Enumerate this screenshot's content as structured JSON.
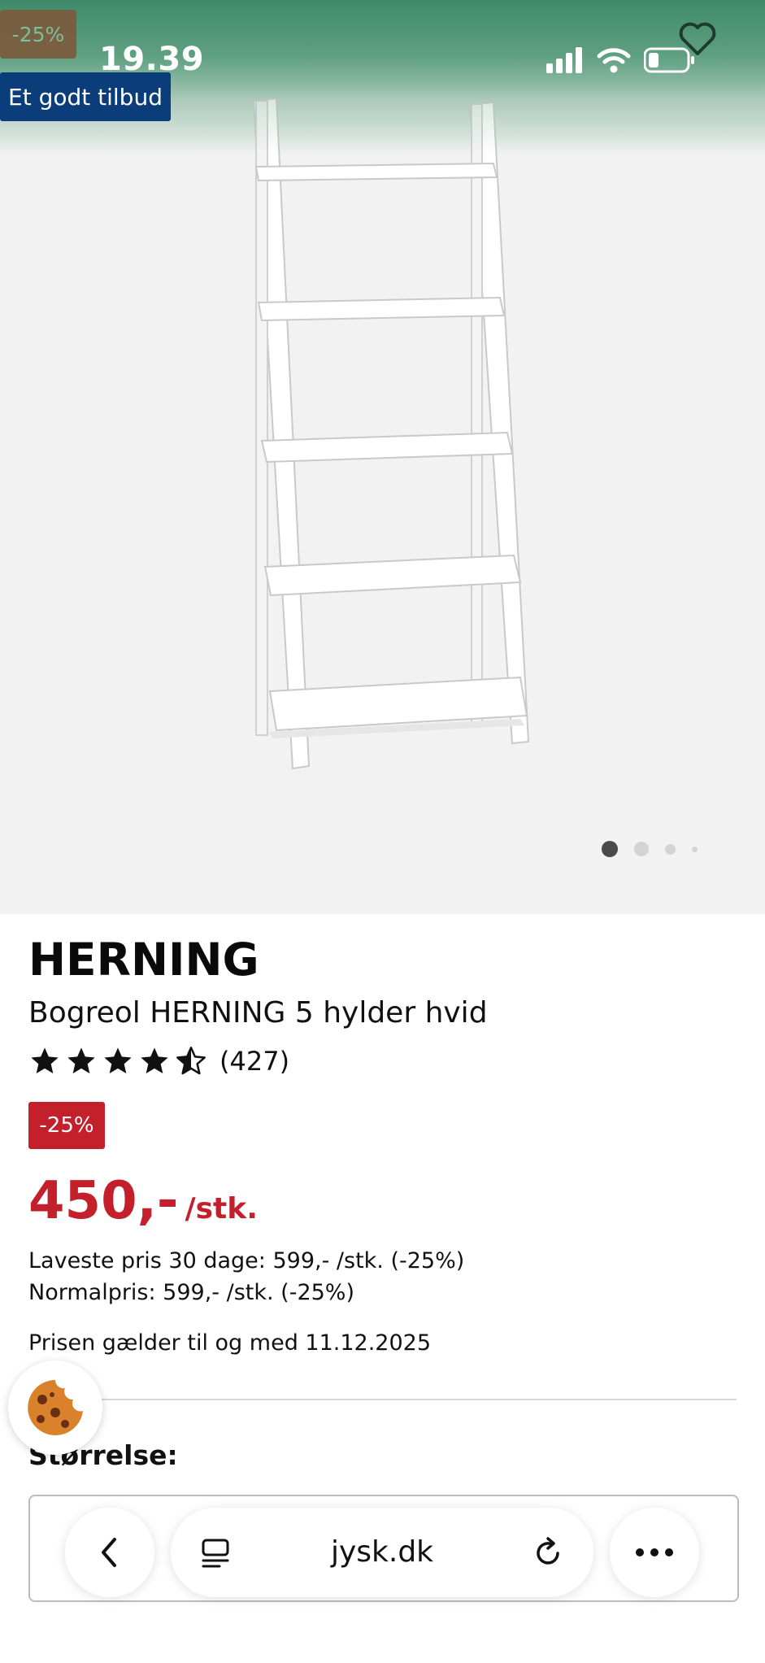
{
  "status_bar": {
    "time": "19.39"
  },
  "hero": {
    "discount_badge": "-25%",
    "offer_tag": "Et godt tilbud",
    "carousel": {
      "count": 4,
      "active_index": 0
    }
  },
  "product": {
    "brand": "HERNING",
    "name": "Bogreol HERNING 5 hylder hvid",
    "rating": {
      "stars": 4.5,
      "max": 5,
      "count_text": "(427)"
    },
    "discount_badge": "-25%",
    "price": {
      "amount": "450,-",
      "unit": "/stk."
    },
    "lowest_price": "Laveste pris 30 dage: 599,- /stk. (-25%)",
    "normal_price": "Normalpris: 599,- /stk. (-25%)",
    "validity": "Prisen gælder til og med 11.12.2025",
    "size_label": "Størrelse:"
  },
  "browser": {
    "url": "jysk.dk"
  },
  "colors": {
    "sale_red": "#c4202b",
    "offer_blue": "#0b3d7a",
    "status_green": "#3f8a6b"
  },
  "icons": [
    "favorite-heart-icon",
    "signal-icon",
    "wifi-icon",
    "battery-icon",
    "star-icon",
    "cookie-icon",
    "back-chevron-icon",
    "tabs-icon",
    "reload-icon",
    "more-icon"
  ]
}
